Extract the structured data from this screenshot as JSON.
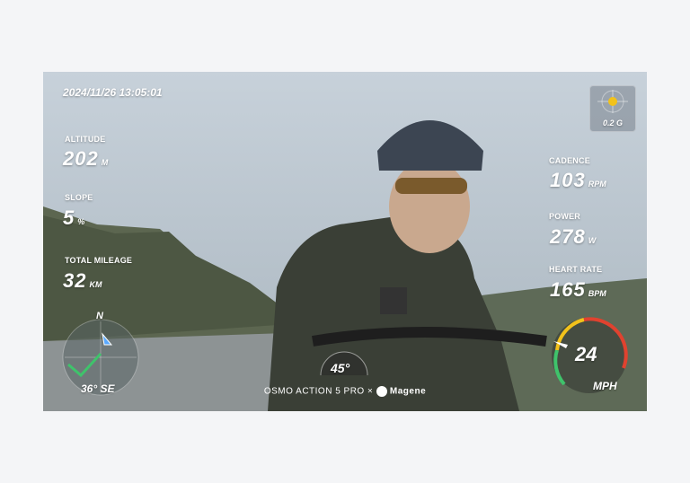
{
  "overlay": {
    "datetime": "2024/11/26  13:05:01",
    "gforce": "0.2 G",
    "altitude": {
      "label": "ALTITUDE",
      "value": "202",
      "unit": "M"
    },
    "slope": {
      "label": "SLOPE",
      "value": "5",
      "unit": "%"
    },
    "mileage": {
      "label": "TOTAL MILEAGE",
      "value": "32",
      "unit": "KM"
    },
    "cadence": {
      "label": "CADENCE",
      "value": "103",
      "unit": "RPM"
    },
    "power": {
      "label": "POWER",
      "value": "278",
      "unit": "W"
    },
    "heart_rate": {
      "label": "HEART RATE",
      "value": "165",
      "unit": "BPM"
    },
    "compass": {
      "north": "N",
      "heading": "36° SE"
    },
    "lean": "45°",
    "speed": {
      "value": "24",
      "unit": "MPH"
    },
    "brand": {
      "camera": "OSMO ACTION 5 PRO",
      "sep": "×",
      "partner": "Magene"
    }
  },
  "colors": {
    "accent_green": "#3fc36b",
    "accent_yellow": "#f2c21b",
    "gauge_red": "#e0422f"
  }
}
